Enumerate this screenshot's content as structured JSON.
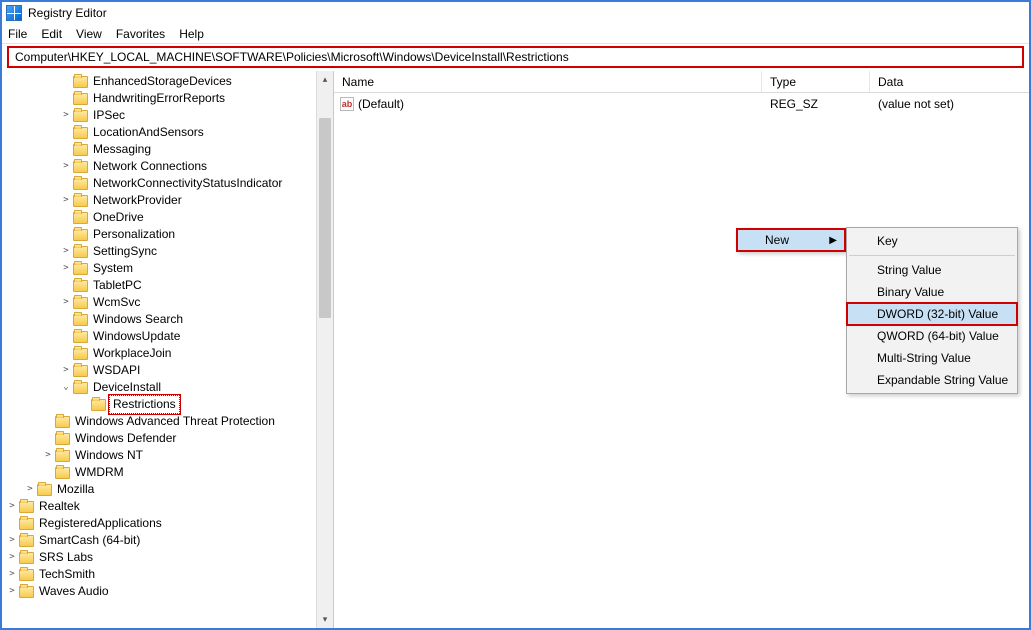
{
  "window": {
    "title": "Registry Editor"
  },
  "menu": {
    "file": "File",
    "edit": "Edit",
    "view": "View",
    "favorites": "Favorites",
    "help": "Help"
  },
  "address": "Computer\\HKEY_LOCAL_MACHINE\\SOFTWARE\\Policies\\Microsoft\\Windows\\DeviceInstall\\Restrictions",
  "tree": {
    "items": [
      {
        "indent": 6,
        "exp": "",
        "label": "EnhancedStorageDevices"
      },
      {
        "indent": 6,
        "exp": "",
        "label": "HandwritingErrorReports"
      },
      {
        "indent": 6,
        "exp": ">",
        "label": "IPSec"
      },
      {
        "indent": 6,
        "exp": "",
        "label": "LocationAndSensors"
      },
      {
        "indent": 6,
        "exp": "",
        "label": "Messaging"
      },
      {
        "indent": 6,
        "exp": ">",
        "label": "Network Connections"
      },
      {
        "indent": 6,
        "exp": "",
        "label": "NetworkConnectivityStatusIndicator"
      },
      {
        "indent": 6,
        "exp": ">",
        "label": "NetworkProvider"
      },
      {
        "indent": 6,
        "exp": "",
        "label": "OneDrive"
      },
      {
        "indent": 6,
        "exp": "",
        "label": "Personalization"
      },
      {
        "indent": 6,
        "exp": ">",
        "label": "SettingSync"
      },
      {
        "indent": 6,
        "exp": ">",
        "label": "System"
      },
      {
        "indent": 6,
        "exp": "",
        "label": "TabletPC"
      },
      {
        "indent": 6,
        "exp": ">",
        "label": "WcmSvc"
      },
      {
        "indent": 6,
        "exp": "",
        "label": "Windows Search"
      },
      {
        "indent": 6,
        "exp": "",
        "label": "WindowsUpdate"
      },
      {
        "indent": 6,
        "exp": "",
        "label": "WorkplaceJoin"
      },
      {
        "indent": 6,
        "exp": ">",
        "label": "WSDAPI"
      },
      {
        "indent": 6,
        "exp": "v",
        "label": "DeviceInstall"
      },
      {
        "indent": 7,
        "exp": "",
        "label": "Restrictions",
        "selected": true
      },
      {
        "indent": 5,
        "exp": "",
        "label": "Windows Advanced Threat Protection"
      },
      {
        "indent": 5,
        "exp": "",
        "label": "Windows Defender"
      },
      {
        "indent": 5,
        "exp": ">",
        "label": "Windows NT"
      },
      {
        "indent": 5,
        "exp": "",
        "label": "WMDRM"
      },
      {
        "indent": 4,
        "exp": ">",
        "label": "Mozilla"
      },
      {
        "indent": 3,
        "exp": ">",
        "label": "Realtek"
      },
      {
        "indent": 3,
        "exp": "",
        "label": "RegisteredApplications"
      },
      {
        "indent": 3,
        "exp": ">",
        "label": "SmartCash (64-bit)"
      },
      {
        "indent": 3,
        "exp": ">",
        "label": "SRS Labs"
      },
      {
        "indent": 3,
        "exp": ">",
        "label": "TechSmith"
      },
      {
        "indent": 3,
        "exp": ">",
        "label": "Waves Audio"
      }
    ]
  },
  "list": {
    "headers": {
      "name": "Name",
      "type": "Type",
      "data": "Data"
    },
    "rows": [
      {
        "icon": "ab",
        "name": "(Default)",
        "type": "REG_SZ",
        "data": "(value not set)"
      }
    ]
  },
  "context": {
    "new": "New",
    "sub": {
      "key": "Key",
      "string": "String Value",
      "binary": "Binary Value",
      "dword": "DWORD (32-bit) Value",
      "qword": "QWORD (64-bit) Value",
      "multi": "Multi-String Value",
      "expand": "Expandable String Value"
    }
  }
}
